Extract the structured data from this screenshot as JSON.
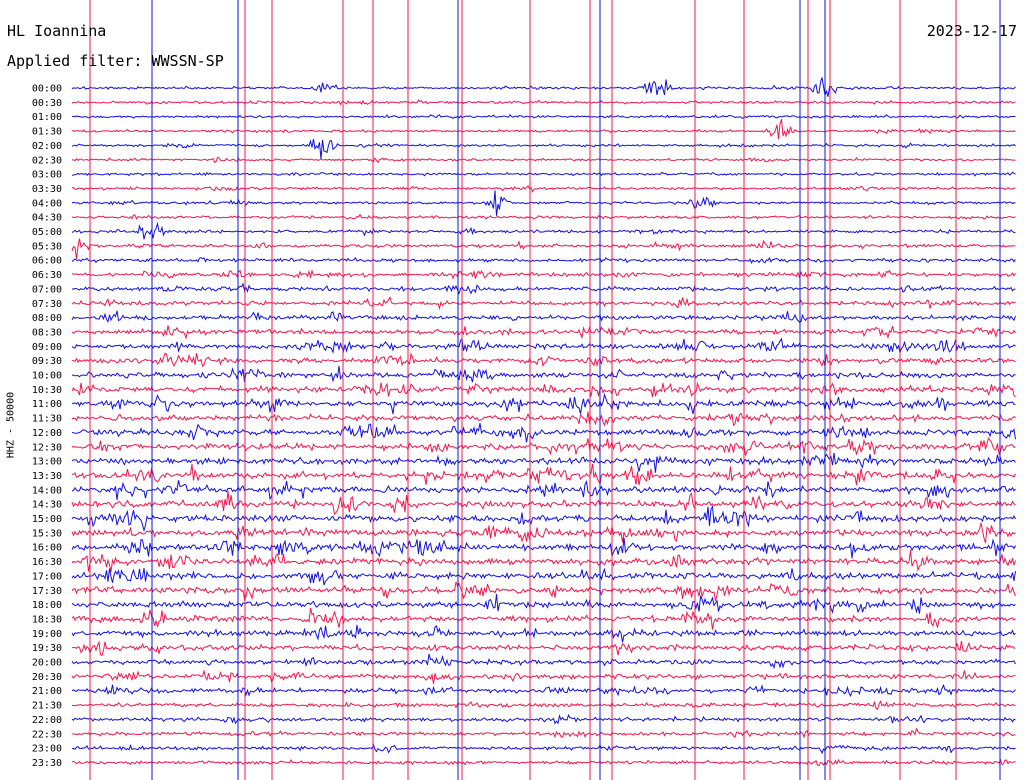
{
  "header": {
    "station": "HL Ioannina",
    "date": "2023-12-17",
    "filter": "Applied filter: WWSSN-SP"
  },
  "colors": {
    "trace_a": "#1010e0",
    "trace_b": "#f0184c",
    "background": "#ffffff"
  },
  "chart_data": {
    "type": "line",
    "ylabel": "HHZ - 50000",
    "rows": [
      "00:00",
      "00:30",
      "01:00",
      "01:30",
      "02:00",
      "02:30",
      "03:00",
      "03:30",
      "04:00",
      "04:30",
      "05:00",
      "05:30",
      "06:00",
      "06:30",
      "07:00",
      "07:30",
      "08:00",
      "08:30",
      "09:00",
      "09:30",
      "10:00",
      "10:30",
      "11:00",
      "11:30",
      "12:00",
      "12:30",
      "13:00",
      "13:30",
      "14:00",
      "14:30",
      "15:00",
      "15:30",
      "16:00",
      "16:30",
      "17:00",
      "17:30",
      "18:00",
      "18:30",
      "19:00",
      "19:30",
      "20:00",
      "20:30",
      "21:00",
      "21:30",
      "22:00",
      "22:30",
      "23:00",
      "23:30"
    ],
    "row_colors": [
      "trace_a",
      "trace_b"
    ],
    "x_minutes_per_row": 30,
    "noise_level": [
      0.08,
      0.08,
      0.06,
      0.06,
      0.07,
      0.07,
      0.08,
      0.1,
      0.1,
      0.12,
      0.16,
      0.2,
      0.22,
      0.25,
      0.3,
      0.28,
      0.35,
      0.38,
      0.42,
      0.45,
      0.5,
      0.5,
      0.52,
      0.55,
      0.55,
      0.58,
      0.6,
      0.62,
      0.6,
      0.6,
      0.62,
      0.62,
      0.6,
      0.6,
      0.58,
      0.58,
      0.55,
      0.55,
      0.5,
      0.45,
      0.4,
      0.35,
      0.3,
      0.28,
      0.25,
      0.22,
      0.2,
      0.18
    ],
    "events": [
      {
        "row": 0,
        "minute": 8.1,
        "amp": 0.9
      },
      {
        "row": 0,
        "minute": 18.6,
        "amp": 1.6
      },
      {
        "row": 0,
        "minute": 23.9,
        "amp": 1.4
      },
      {
        "row": 3,
        "minute": 22.5,
        "amp": 1.2
      },
      {
        "row": 4,
        "minute": 8.0,
        "amp": 2.0
      },
      {
        "row": 8,
        "minute": 13.5,
        "amp": 1.3
      },
      {
        "row": 8,
        "minute": 20.0,
        "amp": 1.3
      },
      {
        "row": 10,
        "minute": 2.5,
        "amp": 1.2
      },
      {
        "row": 11,
        "minute": 0.2,
        "amp": 1.6
      }
    ]
  }
}
